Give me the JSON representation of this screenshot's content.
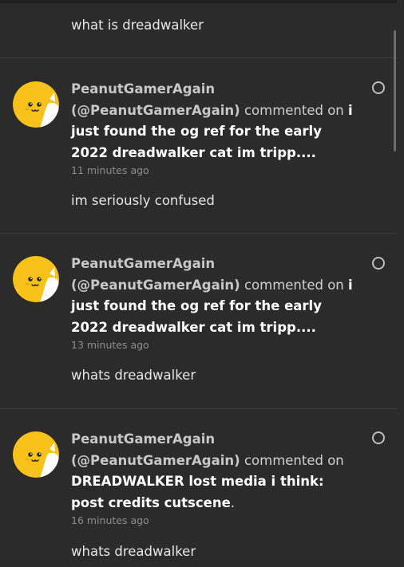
{
  "colors": {
    "background": "#2b2b2b",
    "name_text": "#c7c7c7",
    "title_text": "#ffffff",
    "timestamp_text": "#8d8d8d",
    "avatar_yellow": "#f8c21a"
  },
  "first_fragment": {
    "message": "what is dreadwalker"
  },
  "notifications": [
    {
      "avatar_icon": "yellow-cat-avatar",
      "name": "PeanutGamerAgain",
      "handle": "(@PeanutGamerAgain)",
      "action": "commented on",
      "post_title": "i just found the og ref for the early 2022 dreadwalker cat im tripp....",
      "title_suffix": "",
      "time": "11 minutes ago",
      "message": "im seriously confused"
    },
    {
      "avatar_icon": "yellow-cat-avatar",
      "name": "PeanutGamerAgain",
      "handle": "(@PeanutGamerAgain)",
      "action": "commented on",
      "post_title": "i just found the og ref for the early 2022 dreadwalker cat im tripp....",
      "title_suffix": "",
      "time": "13 minutes ago",
      "message": "whats dreadwalker"
    },
    {
      "avatar_icon": "yellow-cat-avatar",
      "name": "PeanutGamerAgain",
      "handle": "(@PeanutGamerAgain)",
      "action": "commented on",
      "post_title": "DREADWALKER lost media i think: post credits cutscene",
      "title_suffix": ".",
      "time": "16 minutes ago",
      "message": "whats dreadwalker"
    }
  ]
}
